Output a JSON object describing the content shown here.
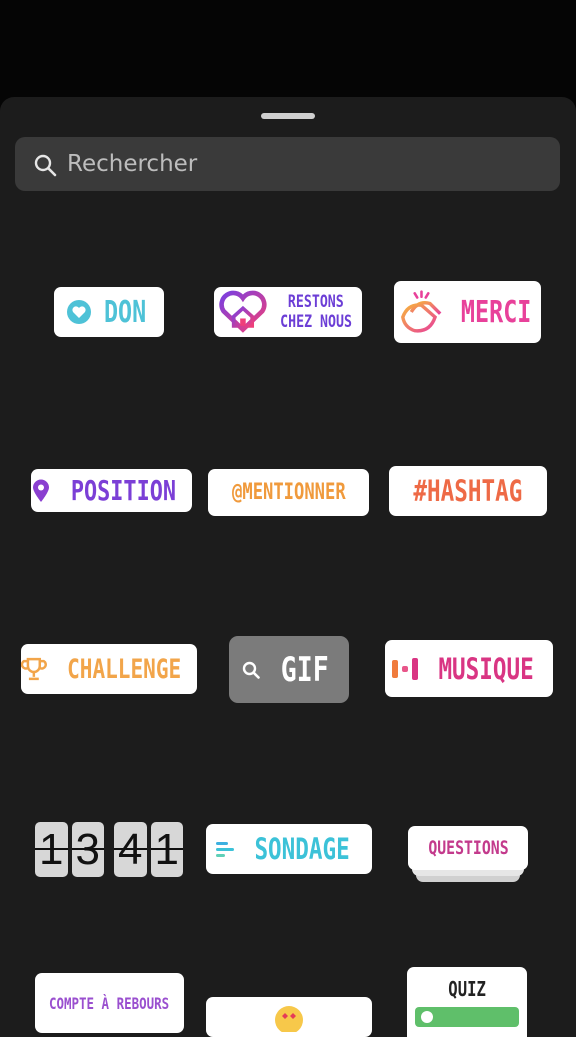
{
  "search": {
    "placeholder": "Rechercher",
    "icon": "search-icon"
  },
  "stickers": {
    "don": "DON",
    "restons_line1": "RESTONS",
    "restons_line2": "CHEZ NOUS",
    "merci": "MERCI",
    "position": "POSITION",
    "mentionner": "@MENTIONNER",
    "hashtag": "#HASHTAG",
    "challenge": "CHALLENGE",
    "gif": "GIF",
    "musique": "MUSIQUE",
    "countdown_digits": [
      "1",
      "3",
      "4",
      "1"
    ],
    "sondage": "SONDAGE",
    "questions": "QUESTIONS",
    "compte": "COMPTE À REBOURS",
    "quiz": "QUIZ"
  },
  "colors": {
    "sheet_bg": "#1c1c1c",
    "search_bg": "#3a3a3a",
    "gif_bg": "#7b7b7b",
    "accent_purple": "#7b3fd6",
    "accent_pink": "#e8419a",
    "accent_cyan": "#4ec2d7",
    "accent_orange": "#f09a3c"
  }
}
